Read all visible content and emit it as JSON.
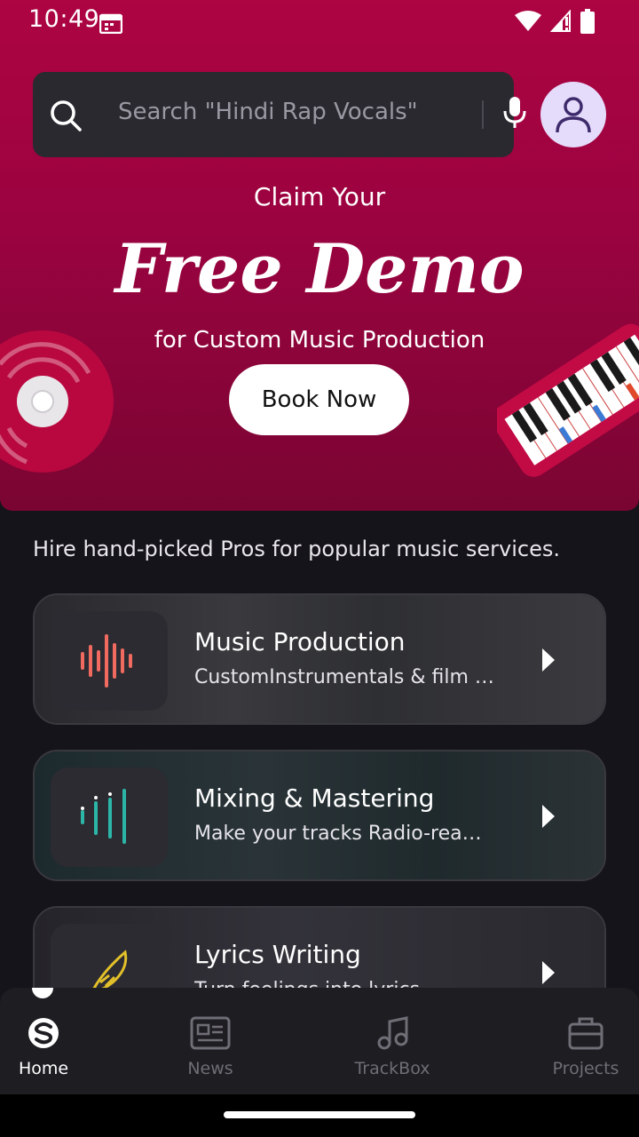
{
  "status_bar": {
    "time": "10:49"
  },
  "search": {
    "placeholder": "Search \"Hindi Rap Vocals\""
  },
  "hero": {
    "claim": "Claim Your",
    "headline": "Free Demo",
    "subline": "for Custom Music Production",
    "cta": "Book Now"
  },
  "hire_text": "Hire hand-picked Pros for popular music services.",
  "services": [
    {
      "title": "Music Production",
      "subtitle": "CustomInstrumentals & film …",
      "icon": "waveform-icon"
    },
    {
      "title": "Mixing & Mastering",
      "subtitle": "Make your tracks Radio-rea…",
      "icon": "levels-icon"
    },
    {
      "title": "Lyrics Writing",
      "subtitle": "Turn feelings into lyrics",
      "icon": "quill-icon"
    }
  ],
  "nav": [
    {
      "label": "Home",
      "icon": "home-logo-icon",
      "active": true
    },
    {
      "label": "News",
      "icon": "news-icon",
      "active": false
    },
    {
      "label": "TrackBox",
      "icon": "music-note-icon",
      "active": false
    },
    {
      "label": "Projects",
      "icon": "briefcase-icon",
      "active": false
    }
  ],
  "colors": {
    "brand": "#a8043f",
    "accent_red": "#f06a5f",
    "accent_teal": "#2bb6a8",
    "accent_yellow": "#e2c02a"
  }
}
